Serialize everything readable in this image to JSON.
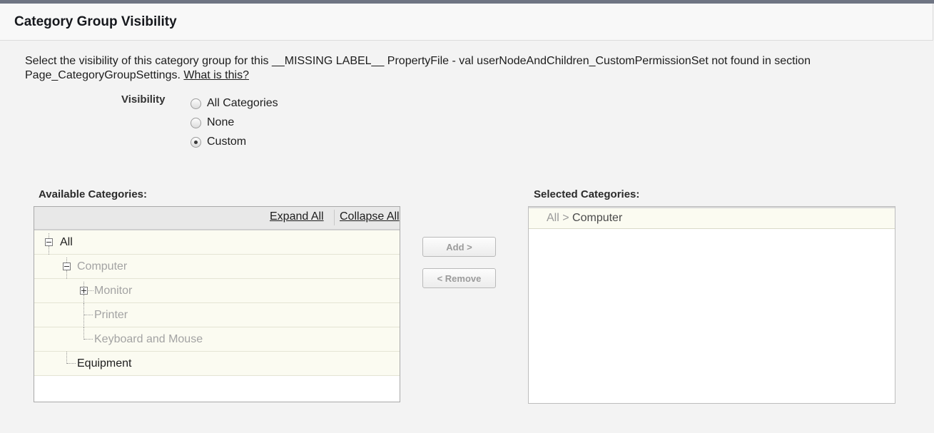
{
  "header": {
    "title": "Category Group Visibility"
  },
  "description": {
    "text": "Select the visibility of this category group for this __MISSING LABEL__ PropertyFile - val userNodeAndChildren_CustomPermissionSet not found in section Page_CategoryGroupSettings.",
    "link": "What is this?"
  },
  "visibility": {
    "label": "Visibility",
    "options": [
      {
        "label": "All Categories",
        "checked": false
      },
      {
        "label": "None",
        "checked": false
      },
      {
        "label": "Custom",
        "checked": true
      }
    ]
  },
  "available": {
    "label": "Available Categories:",
    "expand_all": "Expand All",
    "collapse_all": "Collapse All",
    "tree": [
      {
        "label": "All",
        "toggle": "collapse",
        "state": "active"
      },
      {
        "label": "Computer",
        "toggle": "collapse",
        "state": "dimmed"
      },
      {
        "label": "Monitor",
        "toggle": "expand",
        "state": "dimmed"
      },
      {
        "label": "Printer",
        "toggle": "none",
        "state": "dimmed"
      },
      {
        "label": "Keyboard and Mouse",
        "toggle": "none",
        "state": "dimmed"
      },
      {
        "label": "Equipment",
        "toggle": "none",
        "state": "active"
      }
    ]
  },
  "buttons": {
    "add": "Add >",
    "remove": "< Remove"
  },
  "selected": {
    "label": "Selected Categories:",
    "items": [
      {
        "parent": "All",
        "separator": ">",
        "leaf": "Computer"
      }
    ]
  },
  "colors": {
    "top_accent": "#6f7583",
    "tree_row_bg": "#fbfbf1",
    "dimmed_text": "#a3a3a3",
    "disabled_button_text": "#9b9b9b"
  }
}
